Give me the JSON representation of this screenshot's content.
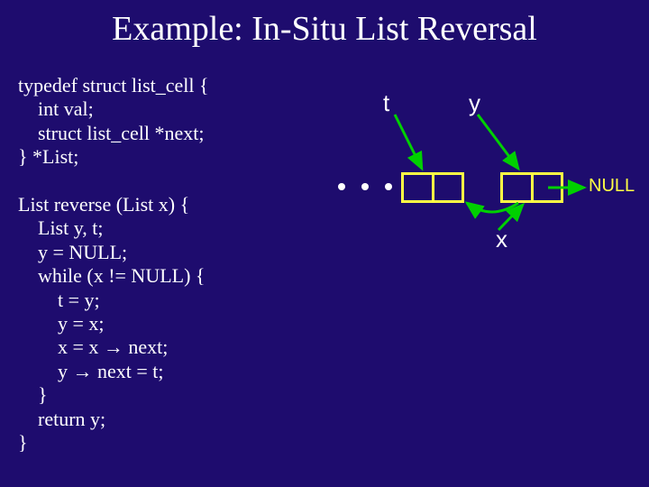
{
  "title": "Example: In-Situ List Reversal",
  "code": {
    "typedef": "typedef struct list_cell {\n    int val;\n    struct list_cell *next;\n} *List;",
    "reverse": "List reverse (List x) {\n    List y, t;\n    y = NULL;\n    while (x != NULL) {\n        t = y;\n        y = x;\n        x = x → next;\n        y → next = t;\n    }\n    return y;\n}"
  },
  "diagram": {
    "var_t": "t",
    "var_y": "y",
    "var_x": "x",
    "null_label": "NULL"
  }
}
